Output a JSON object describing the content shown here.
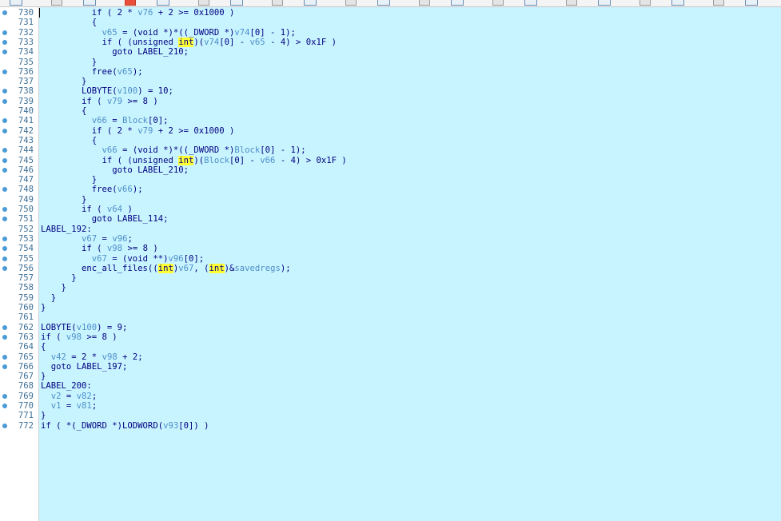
{
  "colors": {
    "code_background": "#c8f4ff",
    "gutter_background": "#ffffff",
    "line_number": "#3d6f96",
    "keyword": "#000080",
    "variable": "#4f8fc9",
    "highlight": "#ffff33",
    "breakpoint_dot": "#4a9bd6"
  },
  "lines": [
    {
      "n": "730",
      "dot": true,
      "parts": [
        {
          "t": "          if ( 2 * ",
          "c": ""
        },
        {
          "t": "v76",
          "c": "var"
        },
        {
          "t": " + 2 >= 0x1000 )",
          "c": ""
        }
      ]
    },
    {
      "n": "731",
      "dot": false,
      "parts": [
        {
          "t": "          {",
          "c": ""
        }
      ]
    },
    {
      "n": "732",
      "dot": true,
      "parts": [
        {
          "t": "            ",
          "c": ""
        },
        {
          "t": "v65",
          "c": "var"
        },
        {
          "t": " = (void *)*((_DWORD *)",
          "c": ""
        },
        {
          "t": "v74",
          "c": "var"
        },
        {
          "t": "[0] - 1);",
          "c": ""
        }
      ]
    },
    {
      "n": "733",
      "dot": true,
      "parts": [
        {
          "t": "            if ( (unsigned ",
          "c": ""
        },
        {
          "t": "int",
          "c": "hl"
        },
        {
          "t": ")(",
          "c": ""
        },
        {
          "t": "v74",
          "c": "var"
        },
        {
          "t": "[0] - ",
          "c": ""
        },
        {
          "t": "v65",
          "c": "var"
        },
        {
          "t": " - 4) > 0x1F )",
          "c": ""
        }
      ]
    },
    {
      "n": "734",
      "dot": true,
      "parts": [
        {
          "t": "              goto LABEL_210;",
          "c": ""
        }
      ]
    },
    {
      "n": "735",
      "dot": false,
      "parts": [
        {
          "t": "          }",
          "c": ""
        }
      ]
    },
    {
      "n": "736",
      "dot": true,
      "parts": [
        {
          "t": "          free(",
          "c": ""
        },
        {
          "t": "v65",
          "c": "var"
        },
        {
          "t": ");",
          "c": ""
        }
      ]
    },
    {
      "n": "737",
      "dot": false,
      "parts": [
        {
          "t": "        }",
          "c": ""
        }
      ]
    },
    {
      "n": "738",
      "dot": true,
      "parts": [
        {
          "t": "        LOBYTE(",
          "c": ""
        },
        {
          "t": "v100",
          "c": "var"
        },
        {
          "t": ") = 10;",
          "c": ""
        }
      ]
    },
    {
      "n": "739",
      "dot": true,
      "parts": [
        {
          "t": "        if ( ",
          "c": ""
        },
        {
          "t": "v79",
          "c": "var"
        },
        {
          "t": " >= 8 )",
          "c": ""
        }
      ]
    },
    {
      "n": "740",
      "dot": false,
      "parts": [
        {
          "t": "        {",
          "c": ""
        }
      ]
    },
    {
      "n": "741",
      "dot": true,
      "parts": [
        {
          "t": "          ",
          "c": ""
        },
        {
          "t": "v66",
          "c": "var"
        },
        {
          "t": " = ",
          "c": ""
        },
        {
          "t": "Block",
          "c": "var"
        },
        {
          "t": "[0];",
          "c": ""
        }
      ]
    },
    {
      "n": "742",
      "dot": true,
      "parts": [
        {
          "t": "          if ( 2 * ",
          "c": ""
        },
        {
          "t": "v79",
          "c": "var"
        },
        {
          "t": " + 2 >= 0x1000 )",
          "c": ""
        }
      ]
    },
    {
      "n": "743",
      "dot": false,
      "parts": [
        {
          "t": "          {",
          "c": ""
        }
      ]
    },
    {
      "n": "744",
      "dot": true,
      "parts": [
        {
          "t": "            ",
          "c": ""
        },
        {
          "t": "v66",
          "c": "var"
        },
        {
          "t": " = (void *)*((_DWORD *)",
          "c": ""
        },
        {
          "t": "Block",
          "c": "var"
        },
        {
          "t": "[0] - 1);",
          "c": ""
        }
      ]
    },
    {
      "n": "745",
      "dot": true,
      "parts": [
        {
          "t": "            if ( (unsigned ",
          "c": ""
        },
        {
          "t": "int",
          "c": "hl"
        },
        {
          "t": ")(",
          "c": ""
        },
        {
          "t": "Block",
          "c": "var"
        },
        {
          "t": "[0] - ",
          "c": ""
        },
        {
          "t": "v66",
          "c": "var"
        },
        {
          "t": " - 4) > 0x1F )",
          "c": ""
        }
      ]
    },
    {
      "n": "746",
      "dot": true,
      "parts": [
        {
          "t": "              goto LABEL_210;",
          "c": ""
        }
      ]
    },
    {
      "n": "747",
      "dot": false,
      "parts": [
        {
          "t": "          }",
          "c": ""
        }
      ]
    },
    {
      "n": "748",
      "dot": true,
      "parts": [
        {
          "t": "          free(",
          "c": ""
        },
        {
          "t": "v66",
          "c": "var"
        },
        {
          "t": ");",
          "c": ""
        }
      ]
    },
    {
      "n": "749",
      "dot": false,
      "parts": [
        {
          "t": "        }",
          "c": ""
        }
      ]
    },
    {
      "n": "750",
      "dot": true,
      "parts": [
        {
          "t": "        if ( ",
          "c": ""
        },
        {
          "t": "v64",
          "c": "var"
        },
        {
          "t": " )",
          "c": ""
        }
      ]
    },
    {
      "n": "751",
      "dot": true,
      "parts": [
        {
          "t": "          goto LABEL_114;",
          "c": ""
        }
      ]
    },
    {
      "n": "752",
      "dot": false,
      "parts": [
        {
          "t": "LABEL_192:",
          "c": ""
        }
      ]
    },
    {
      "n": "753",
      "dot": true,
      "parts": [
        {
          "t": "        ",
          "c": ""
        },
        {
          "t": "v67",
          "c": "var"
        },
        {
          "t": " = ",
          "c": ""
        },
        {
          "t": "v96",
          "c": "var"
        },
        {
          "t": ";",
          "c": ""
        }
      ]
    },
    {
      "n": "754",
      "dot": true,
      "parts": [
        {
          "t": "        if ( ",
          "c": ""
        },
        {
          "t": "v98",
          "c": "var"
        },
        {
          "t": " >= 8 )",
          "c": ""
        }
      ]
    },
    {
      "n": "755",
      "dot": true,
      "parts": [
        {
          "t": "          ",
          "c": ""
        },
        {
          "t": "v67",
          "c": "var"
        },
        {
          "t": " = (void **)",
          "c": ""
        },
        {
          "t": "v96",
          "c": "var"
        },
        {
          "t": "[0];",
          "c": ""
        }
      ]
    },
    {
      "n": "756",
      "dot": true,
      "parts": [
        {
          "t": "        enc_all_files((",
          "c": ""
        },
        {
          "t": "int",
          "c": "hl"
        },
        {
          "t": ")",
          "c": ""
        },
        {
          "t": "v67",
          "c": "var"
        },
        {
          "t": ", (",
          "c": ""
        },
        {
          "t": "int",
          "c": "hl"
        },
        {
          "t": ")&",
          "c": ""
        },
        {
          "t": "savedregs",
          "c": "var"
        },
        {
          "t": ");",
          "c": ""
        }
      ]
    },
    {
      "n": "757",
      "dot": false,
      "parts": [
        {
          "t": "      }",
          "c": ""
        }
      ]
    },
    {
      "n": "758",
      "dot": false,
      "parts": [
        {
          "t": "    }",
          "c": ""
        }
      ]
    },
    {
      "n": "759",
      "dot": false,
      "parts": [
        {
          "t": "  }",
          "c": ""
        }
      ]
    },
    {
      "n": "760",
      "dot": false,
      "parts": [
        {
          "t": "}",
          "c": ""
        }
      ]
    },
    {
      "n": "761",
      "dot": false,
      "parts": [
        {
          "t": "",
          "c": ""
        }
      ]
    },
    {
      "n": "762",
      "dot": true,
      "parts": [
        {
          "t": "LOBYTE(",
          "c": ""
        },
        {
          "t": "v100",
          "c": "var"
        },
        {
          "t": ") = 9;",
          "c": ""
        }
      ]
    },
    {
      "n": "763",
      "dot": true,
      "parts": [
        {
          "t": "if ( ",
          "c": ""
        },
        {
          "t": "v98",
          "c": "var"
        },
        {
          "t": " >= 8 )",
          "c": ""
        }
      ]
    },
    {
      "n": "764",
      "dot": false,
      "parts": [
        {
          "t": "{",
          "c": ""
        }
      ]
    },
    {
      "n": "765",
      "dot": true,
      "parts": [
        {
          "t": "  ",
          "c": ""
        },
        {
          "t": "v42",
          "c": "var"
        },
        {
          "t": " = 2 * ",
          "c": ""
        },
        {
          "t": "v98",
          "c": "var"
        },
        {
          "t": " + 2;",
          "c": ""
        }
      ]
    },
    {
      "n": "766",
      "dot": true,
      "parts": [
        {
          "t": "  goto LABEL_197;",
          "c": ""
        }
      ]
    },
    {
      "n": "767",
      "dot": false,
      "parts": [
        {
          "t": "}",
          "c": ""
        }
      ]
    },
    {
      "n": "768",
      "dot": false,
      "parts": [
        {
          "t": "LABEL_200:",
          "c": ""
        }
      ]
    },
    {
      "n": "769",
      "dot": true,
      "parts": [
        {
          "t": "  ",
          "c": ""
        },
        {
          "t": "v2",
          "c": "var"
        },
        {
          "t": " = ",
          "c": ""
        },
        {
          "t": "v82",
          "c": "var"
        },
        {
          "t": ";",
          "c": ""
        }
      ]
    },
    {
      "n": "770",
      "dot": true,
      "parts": [
        {
          "t": "  ",
          "c": ""
        },
        {
          "t": "v1",
          "c": "var"
        },
        {
          "t": " = ",
          "c": ""
        },
        {
          "t": "v81",
          "c": "var"
        },
        {
          "t": ";",
          "c": ""
        }
      ]
    },
    {
      "n": "771",
      "dot": false,
      "parts": [
        {
          "t": "}",
          "c": ""
        }
      ]
    },
    {
      "n": "772",
      "dot": true,
      "parts": [
        {
          "t": "if ( *(_DWORD *)LODWORD(",
          "c": ""
        },
        {
          "t": "v93",
          "c": "var"
        },
        {
          "t": "[0]) )",
          "c": ""
        }
      ]
    }
  ]
}
